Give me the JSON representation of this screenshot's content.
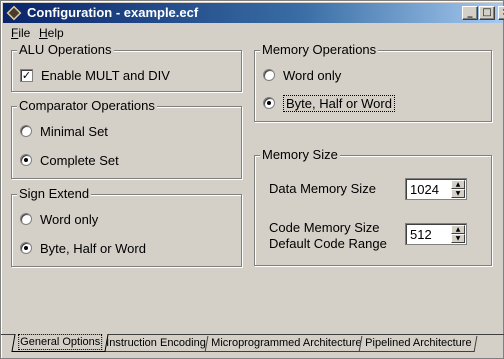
{
  "window": {
    "title": "Configuration - example.ecf"
  },
  "titlebar_buttons": {
    "minimize": "_",
    "maximize": "□",
    "close": "×"
  },
  "menu": [
    "File",
    "Help"
  ],
  "alu": {
    "title": "ALU Operations",
    "option": "Enable MULT and DIV",
    "checked": true
  },
  "comparator": {
    "title": "Comparator Operations",
    "options": [
      "Minimal Set",
      "Complete Set"
    ],
    "selected": 1
  },
  "sign_extend": {
    "title": "Sign Extend",
    "options": [
      "Word only",
      "Byte, Half or Word"
    ],
    "selected": 1
  },
  "memory_ops": {
    "title": "Memory Operations",
    "options": [
      "Word only",
      "Byte, Half or Word"
    ],
    "selected": 1
  },
  "memory_size": {
    "title": "Memory Size",
    "data_label": "Data Memory Size",
    "data_value": "1024",
    "code_label_1": "Code Memory Size",
    "code_label_2": "Default Code Range",
    "code_value": "512"
  },
  "spin_glyphs": {
    "up": "▲",
    "down": "▼"
  },
  "check_glyph": "✓",
  "tabs": [
    "General Options",
    "Instruction Encoding",
    "Microprogrammed Architecture",
    "Pipelined Architecture"
  ],
  "active_tab": 0
}
